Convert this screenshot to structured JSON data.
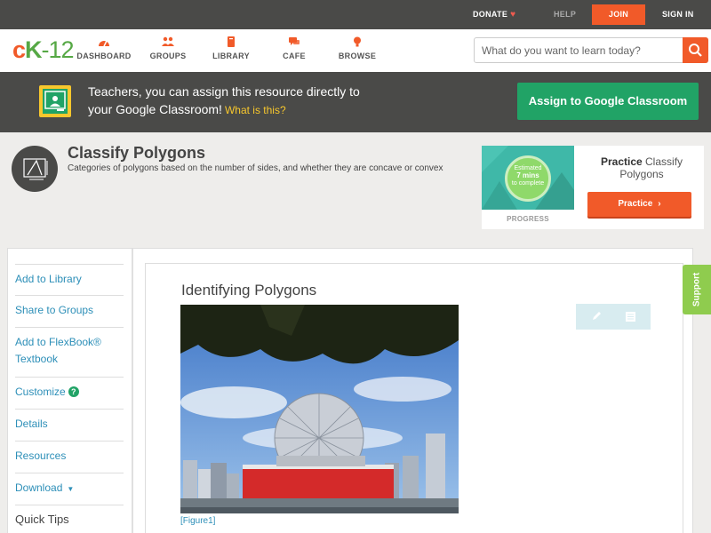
{
  "topbar": {
    "donate": "DONATE",
    "help": "HELP",
    "join": "JOIN",
    "signin": "SIGN IN"
  },
  "nav": {
    "logo_c": "c",
    "logo_k": "K",
    "logo_n": "-12",
    "items": [
      {
        "label": "DASHBOARD",
        "icon": "dashboard-icon"
      },
      {
        "label": "GROUPS",
        "icon": "groups-icon"
      },
      {
        "label": "LIBRARY",
        "icon": "library-icon"
      },
      {
        "label": "CAFE",
        "icon": "cafe-icon"
      },
      {
        "label": "BROWSE",
        "icon": "browse-icon"
      }
    ],
    "search_placeholder": "What do you want to learn today?"
  },
  "classroom": {
    "line1": "Teachers, you can assign this resource directly to",
    "line2": "your Google Classroom!",
    "what": "What is this?",
    "button": "Assign to Google Classroom"
  },
  "concept": {
    "title": "Classify Polygons",
    "description": "Categories of polygons based on the number of sides, and whether they are concave or convex"
  },
  "practice": {
    "est_l1": "Estimated",
    "est_l2": "7 mins",
    "est_l3": "to complete",
    "progress_label": "PROGRESS",
    "title_bold": "Practice",
    "title_rest": "Classify Polygons",
    "button": "Practice"
  },
  "sidebar": {
    "items": [
      "Add to Library",
      "Share to Groups",
      "Add to FlexBook®",
      "Textbook",
      "Customize",
      "Details",
      "Resources",
      "Download"
    ],
    "quick_tips": "Quick Tips"
  },
  "content": {
    "title": "Identifying Polygons",
    "figure_caption": "[Figure1]"
  },
  "support": "Support",
  "colors": {
    "accent": "#f15a29",
    "green": "#21a366",
    "dark": "#4a4a48",
    "link": "#2d8fb8"
  }
}
